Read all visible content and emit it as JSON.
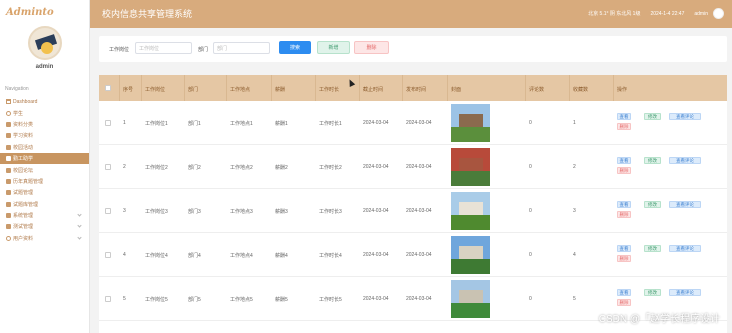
{
  "sidebar": {
    "brand": "Adminto",
    "username": "admin",
    "nav_title": "Navigation",
    "items": [
      {
        "label": "Dashboard",
        "icon": "home-icon"
      },
      {
        "label": "学生",
        "icon": "user-icon"
      },
      {
        "label": "资料分类",
        "icon": "grid-icon"
      },
      {
        "label": "学习资料",
        "icon": "grid-icon"
      },
      {
        "label": "校园活动",
        "icon": "grid-icon"
      },
      {
        "label": "勤工助学",
        "icon": "grid-icon",
        "active": true
      },
      {
        "label": "校园论坛",
        "icon": "grid-icon"
      },
      {
        "label": "历年真题管理",
        "icon": "grid-icon"
      },
      {
        "label": "试题管理",
        "icon": "grid-icon"
      },
      {
        "label": "试题库管理",
        "icon": "grid-icon"
      },
      {
        "label": "系统管理",
        "icon": "grid-icon",
        "expandable": true
      },
      {
        "label": "测试管理",
        "icon": "grid-icon",
        "expandable": true
      },
      {
        "label": "用户资料",
        "icon": "user-icon",
        "expandable": true
      }
    ]
  },
  "topbar": {
    "title": "校内信息共享管理系统",
    "weather": "北京 5.1°  阴  东北风  1级",
    "datetime": "2024-1-4 22:47",
    "user": "admin"
  },
  "search": {
    "position_label": "工作岗位",
    "position_placeholder": "工作岗位",
    "dept_label": "部门",
    "dept_placeholder": "部门",
    "search_button": "搜索",
    "add_button": "新增",
    "delete_button": "删除"
  },
  "table": {
    "columns": [
      "序号",
      "工作岗位",
      "部门",
      "工作地点",
      "薪酬",
      "工作时长",
      "截止时间",
      "发布时间",
      "封面",
      "评论数",
      "收藏数",
      "操作"
    ],
    "rows": [
      {
        "no": "1",
        "position": "工作岗位1",
        "dept": "部门1",
        "location": "工作地点1",
        "salary": "薪酬1",
        "hours": "工作时长1",
        "deadline": "2024-03-04",
        "published": "2024-03-04",
        "comments": "0",
        "favorites": "1"
      },
      {
        "no": "2",
        "position": "工作岗位2",
        "dept": "部门2",
        "location": "工作地点2",
        "salary": "薪酬2",
        "hours": "工作时长2",
        "deadline": "2024-03-04",
        "published": "2024-03-04",
        "comments": "0",
        "favorites": "2"
      },
      {
        "no": "3",
        "position": "工作岗位3",
        "dept": "部门3",
        "location": "工作地点3",
        "salary": "薪酬3",
        "hours": "工作时长3",
        "deadline": "2024-03-04",
        "published": "2024-03-04",
        "comments": "0",
        "favorites": "3"
      },
      {
        "no": "4",
        "position": "工作岗位4",
        "dept": "部门4",
        "location": "工作地点4",
        "salary": "薪酬4",
        "hours": "工作时长4",
        "deadline": "2024-03-04",
        "published": "2024-03-04",
        "comments": "0",
        "favorites": "4"
      },
      {
        "no": "5",
        "position": "工作岗位5",
        "dept": "部门5",
        "location": "工作地点5",
        "salary": "薪酬5",
        "hours": "工作时长5",
        "deadline": "2024-03-04",
        "published": "2024-03-04",
        "comments": "0",
        "favorites": "5"
      }
    ],
    "ops": {
      "view": "查看",
      "edit": "修改",
      "comments": "查看评论",
      "delete": "删除"
    }
  },
  "watermark": "CSDN @「赵学长程序设计"
}
